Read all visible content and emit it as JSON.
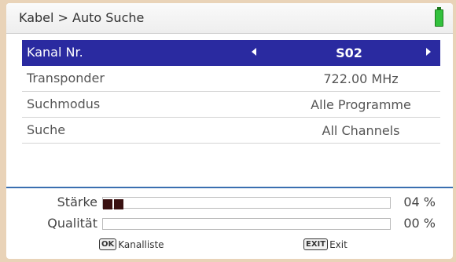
{
  "header": {
    "title": "Kabel > Auto Suche",
    "battery_icon": "battery-full-icon"
  },
  "rows": [
    {
      "label": "Kanal Nr.",
      "value": "S02"
    },
    {
      "label": "Transponder",
      "value": "722.00 MHz"
    },
    {
      "label": "Suchmodus",
      "value": "Alle Programme"
    },
    {
      "label": "Suche",
      "value": "All Channels"
    }
  ],
  "signal": {
    "strength_label": "Stärke",
    "strength_value": "04 %",
    "strength_level": 0.04,
    "quality_label": "Qualität",
    "quality_value": "00 %",
    "quality_level": 0.0
  },
  "footer": {
    "ok_key": "OK",
    "ok_label": "Kanalliste",
    "exit_key": "EXIT",
    "exit_label": "Exit"
  },
  "colors": {
    "selected_row": "#2a2aa0",
    "separator": "#3a6fb0",
    "battery": "#33c13d",
    "meter_fill": "#3a1111"
  }
}
